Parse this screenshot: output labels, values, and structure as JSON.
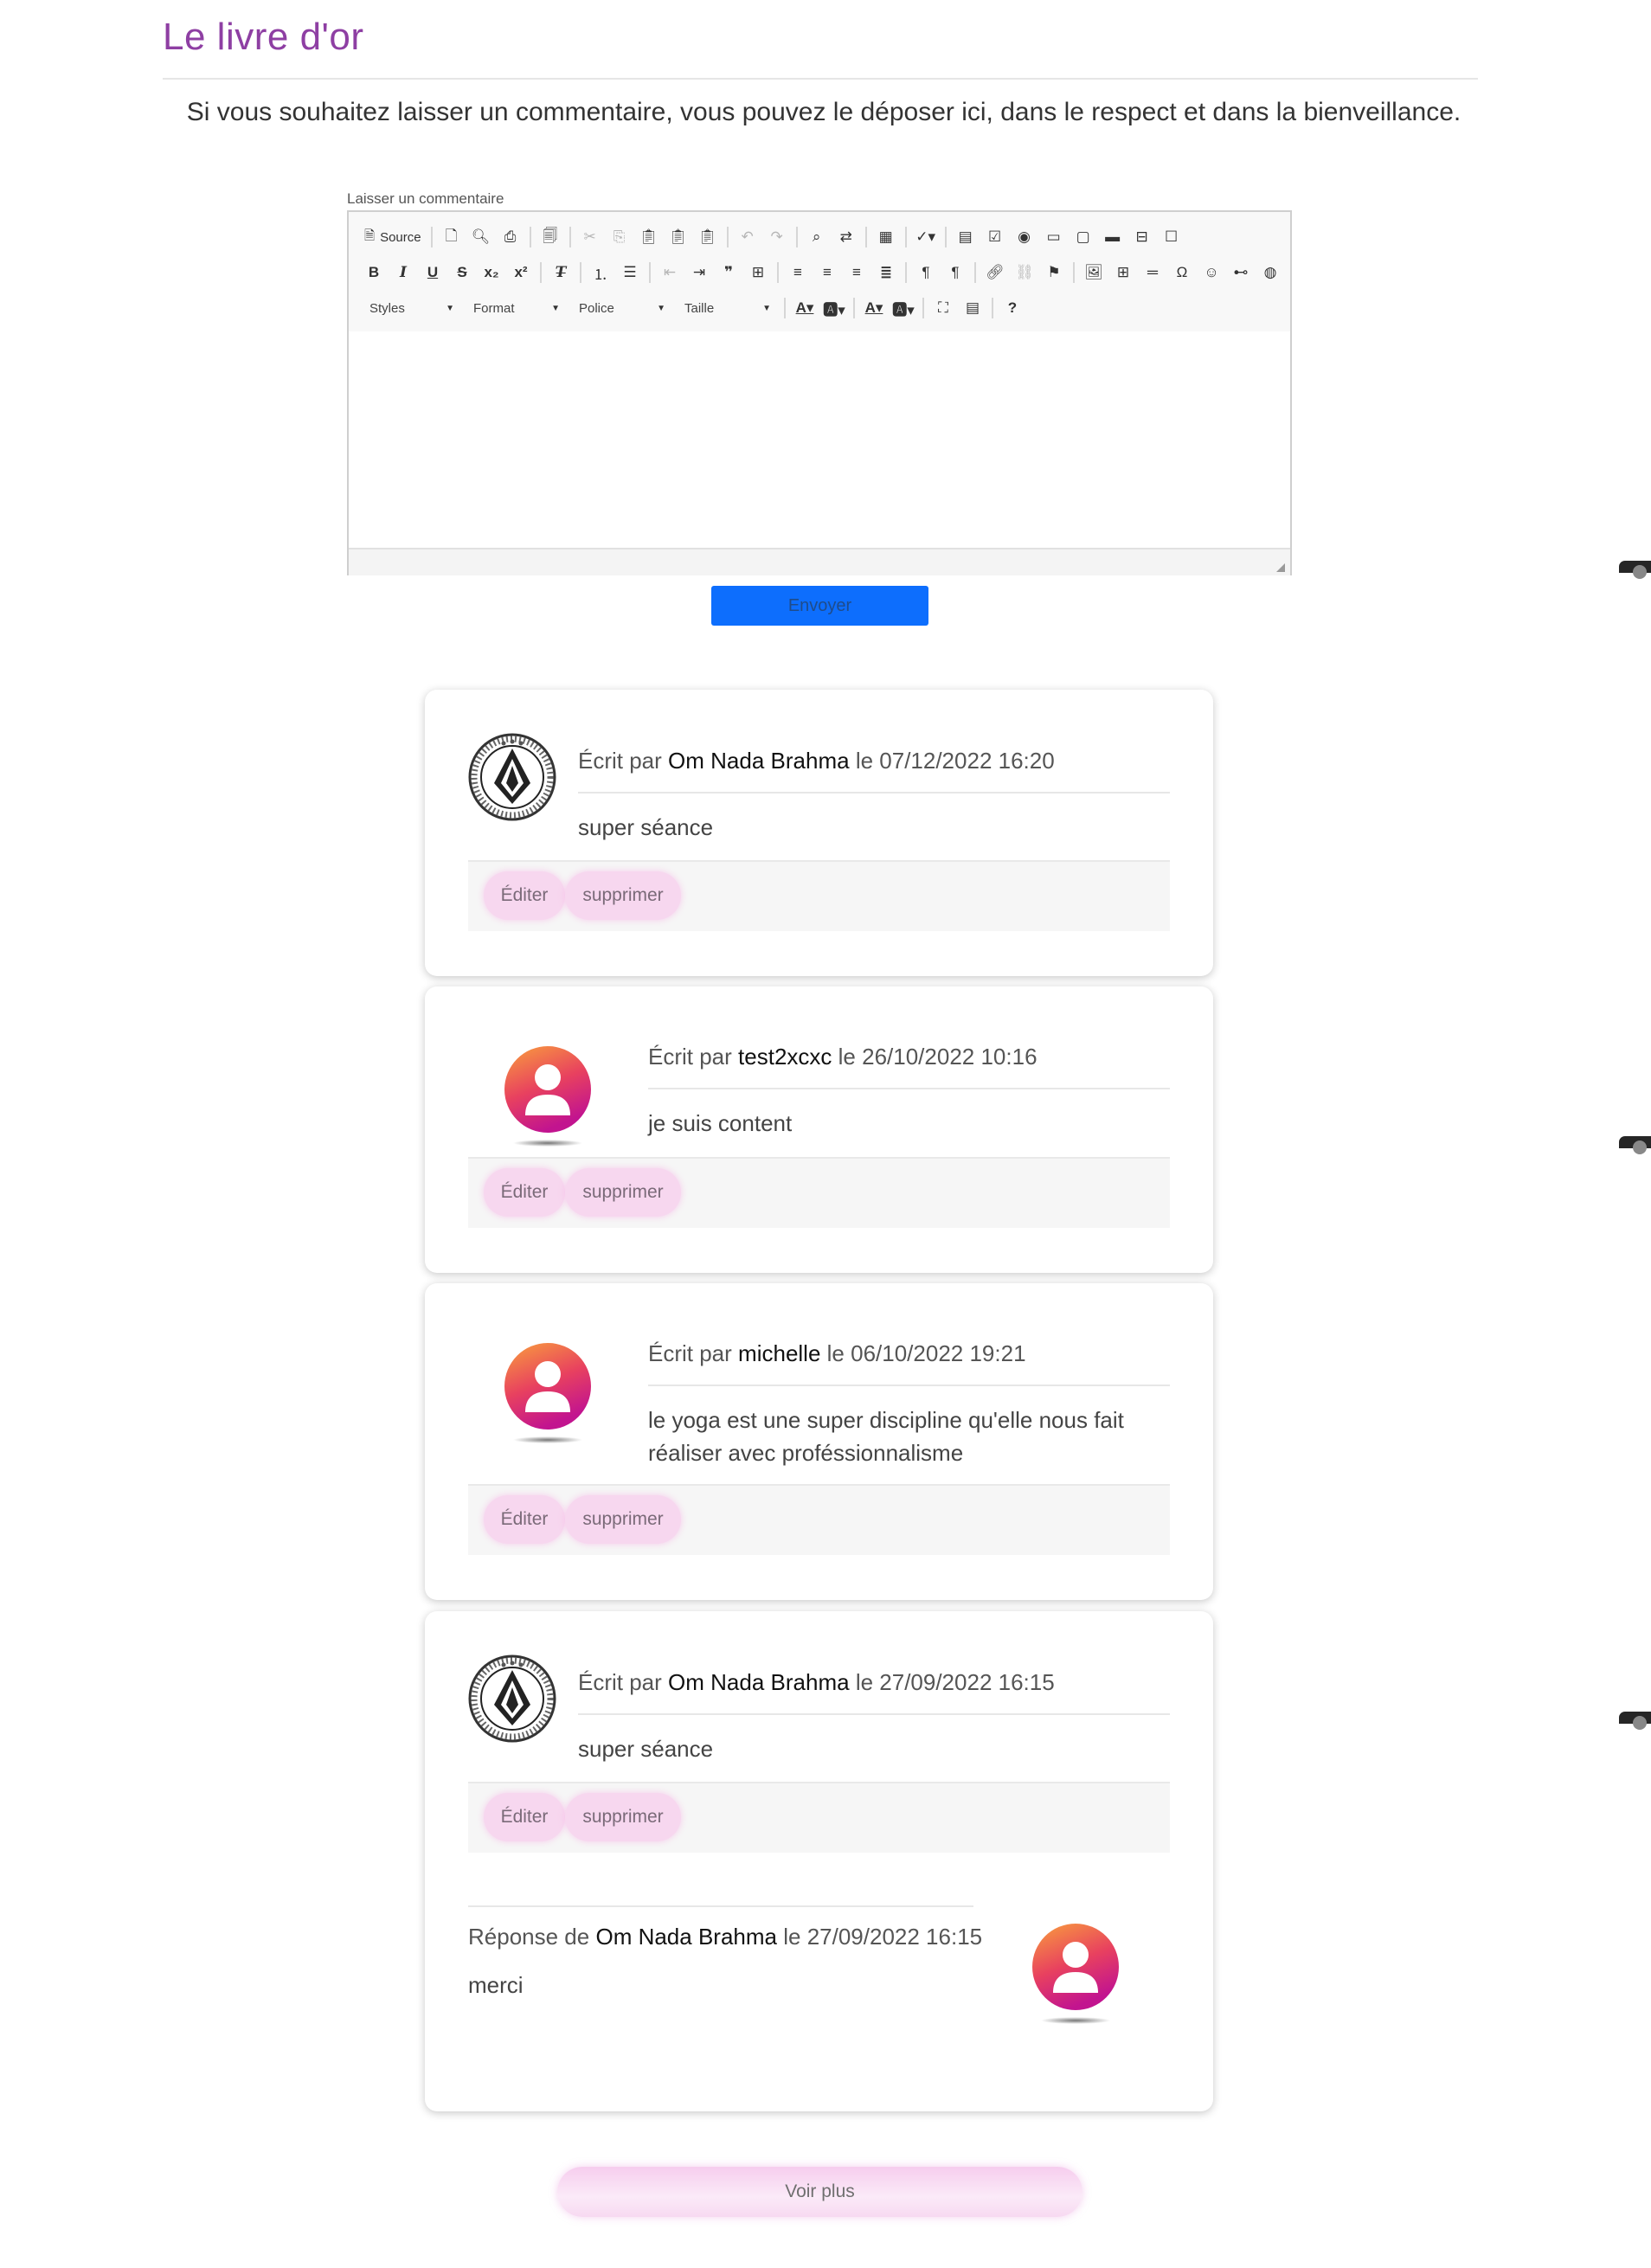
{
  "page": {
    "title": "Le livre d'or",
    "intro": "Si vous souhaitez laisser un commentaire, vous pouvez le déposer ici, dans le respect et dans la bienveillance."
  },
  "editor": {
    "label": "Laisser un commentaire",
    "source_label": "Source",
    "combos": {
      "styles": "Styles",
      "format": "Format",
      "font": "Police",
      "size": "Taille"
    },
    "submit_label": "Envoyer"
  },
  "comments": [
    {
      "written_by": "Écrit par",
      "author": "Om Nada Brahma",
      "date": "le 07/12/2022 16:20",
      "text": "super séance",
      "avatar": "logo"
    },
    {
      "written_by": "Écrit par",
      "author": "test2xcxc",
      "date": "le 26/10/2022 10:16",
      "text": "je suis content",
      "avatar": "user-icon"
    },
    {
      "written_by": "Écrit par",
      "author": "michelle",
      "date": "le 06/10/2022 19:21",
      "text": "le yoga est une super discipline qu'elle nous fait réaliser avec proféssionnalisme",
      "avatar": "user-icon"
    },
    {
      "written_by": "Écrit par",
      "author": "Om Nada Brahma",
      "date": "le 27/09/2022 16:15",
      "text": "super séance",
      "avatar": "logo",
      "reply": {
        "reply_by": "Réponse de",
        "author": "Om Nada Brahma",
        "date": "le 27/09/2022 16:15",
        "text": "merci",
        "avatar": "user-icon"
      }
    }
  ],
  "actions": {
    "edit": "Éditer",
    "delete": "supprimer"
  },
  "load_more": "Voir plus",
  "colors": {
    "title": "#8e3fa3",
    "submit": "#0d6efd",
    "pill": "#f7d7ef",
    "avatar_gradient": [
      "#f9a03c",
      "#c2148f"
    ]
  }
}
